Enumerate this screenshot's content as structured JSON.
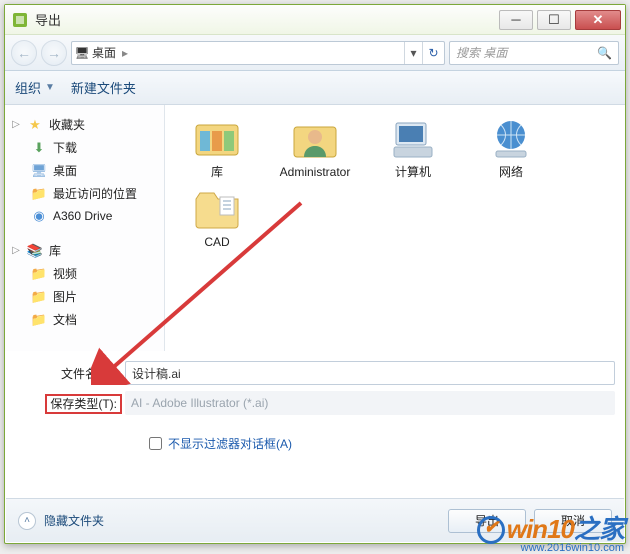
{
  "window": {
    "title": "导出"
  },
  "nav": {
    "location": "桌面",
    "search_placeholder": "搜索 桌面"
  },
  "toolbar": {
    "organize": "组织",
    "new_folder": "新建文件夹"
  },
  "sidebar": {
    "favorites": "收藏夹",
    "downloads": "下载",
    "desktop": "桌面",
    "recent": "最近访问的位置",
    "a360": "A360 Drive",
    "libraries": "库",
    "videos": "视频",
    "pictures": "图片",
    "documents": "文档"
  },
  "items": [
    {
      "label": "库"
    },
    {
      "label": "Administrator"
    },
    {
      "label": "计算机"
    },
    {
      "label": "网络"
    },
    {
      "label": "CAD"
    }
  ],
  "form": {
    "filename_label": "文件名(N):",
    "filename_value": "设计稿.ai",
    "savetype_label": "保存类型(T):",
    "savetype_value": "AI - Adobe Illustrator (*.ai)",
    "checkbox_label": "不显示过滤器对话框(A)"
  },
  "footer": {
    "hide_folders": "隐藏文件夹",
    "export": "导出",
    "cancel": "取消"
  },
  "watermark": {
    "brand_a": "win10",
    "brand_b": "之家",
    "url": "www.2016win10.com"
  }
}
